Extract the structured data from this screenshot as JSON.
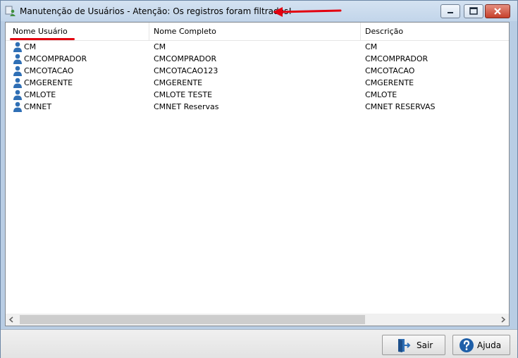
{
  "window": {
    "title": "Manutenção de Usuários - Atenção: Os registros foram filtrados!",
    "controls": [
      "minimize",
      "maximize",
      "close"
    ]
  },
  "table": {
    "columns": [
      "Nome Usuário",
      "Nome Completo",
      "Descrição"
    ],
    "sorted_column": "Nome Usuário",
    "rows": [
      {
        "user": "CM",
        "full_name": "CM",
        "description": "CM"
      },
      {
        "user": "CMCOMPRADOR",
        "full_name": "CMCOMPRADOR",
        "description": "CMCOMPRADOR"
      },
      {
        "user": "CMCOTACAO",
        "full_name": "CMCOTACAO123",
        "description": "CMCOTACAO"
      },
      {
        "user": "CMGERENTE",
        "full_name": "CMGERENTE",
        "description": "CMGERENTE"
      },
      {
        "user": "CMLOTE",
        "full_name": "CMLOTE TESTE",
        "description": "CMLOTE"
      },
      {
        "user": "CMNET",
        "full_name": "CMNET Reservas",
        "description": "CMNET RESERVAS"
      }
    ]
  },
  "buttons": {
    "sair": "Sair",
    "ajuda": "Ajuda"
  },
  "icons": {
    "app": "users-app-icon",
    "row": "user-icon",
    "sair": "exit-door-icon",
    "ajuda": "help-question-icon"
  },
  "colors": {
    "annotation_red": "#e3000f",
    "user_icon_blue": "#2f6fb5",
    "help_blue": "#1f5fa8"
  }
}
